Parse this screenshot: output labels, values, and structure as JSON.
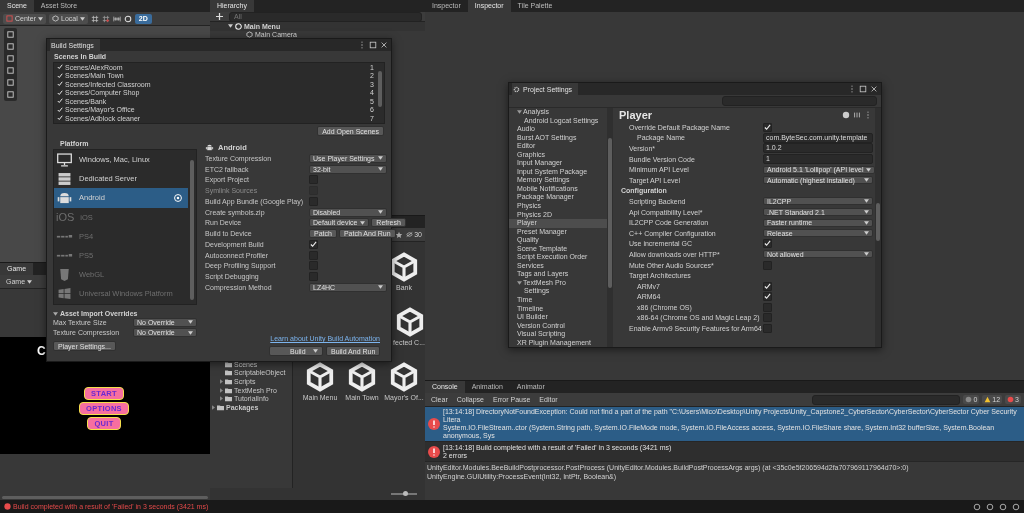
{
  "scene_panel": {
    "tabs": [
      {
        "label": "Scene",
        "selected": true
      },
      {
        "label": "Asset Store",
        "selected": false
      }
    ],
    "toolbar": {
      "pivot": "Center",
      "space": "Local",
      "toggle_2d": {
        "label": "2D",
        "on": true
      }
    }
  },
  "hierarchy": {
    "title": "Hierarchy",
    "search": {
      "placeholder": "All"
    },
    "items": [
      {
        "label": "Main Menu",
        "expanded": true,
        "children": [
          {
            "label": "Main Camera"
          }
        ]
      }
    ]
  },
  "inspector_panel": {
    "tabs": [
      {
        "label": "Inspector",
        "selected": false
      },
      {
        "label": "Inspector",
        "selected": true
      },
      {
        "label": "Tile Palette",
        "selected": false
      }
    ]
  },
  "game_panel": {
    "tab": "Game",
    "display": "Game",
    "title_fragment": "C",
    "menu_buttons": [
      "START",
      "OPTIONS",
      "QUIT"
    ]
  },
  "project_panel": {
    "count": "30",
    "asset_folders": [
      {
        "label": "Scenes",
        "expandable": false
      },
      {
        "label": "ScriptableObject",
        "expandable": false
      },
      {
        "label": "Scripts",
        "expandable": true
      },
      {
        "label": "TextMesh Pro",
        "expandable": true
      },
      {
        "label": "TutorialInfo",
        "expandable": true
      }
    ],
    "root_folders": [
      {
        "label": "Packages",
        "expandable": true
      }
    ],
    "assets": [
      "Bank",
      "fected C...",
      "Main Menu",
      "Main Town",
      "Mayor's Of..."
    ],
    "zoom_slider": {
      "level": 0.55
    }
  },
  "build_settings": {
    "title": "Build Settings",
    "scenes_header": "Scenes In Build",
    "scenes": [
      {
        "path": "Scenes/AlexRoom",
        "index": "1",
        "checked": true
      },
      {
        "path": "Scenes/Main Town",
        "index": "2",
        "checked": true
      },
      {
        "path": "Scenes/Infected Classroom",
        "index": "3",
        "checked": true
      },
      {
        "path": "Scenes/Computer Shop",
        "index": "4",
        "checked": true
      },
      {
        "path": "Scenes/Bank",
        "index": "5",
        "checked": true
      },
      {
        "path": "Scenes/Mayor's Office",
        "index": "6",
        "checked": true
      },
      {
        "path": "Scenes/Adblock cleaner",
        "index": "7",
        "checked": true
      }
    ],
    "add_open_scenes": "Add Open Scenes",
    "platform_header": "Platform",
    "platforms": [
      {
        "name": "Windows, Mac, Linux",
        "kind": "monitor",
        "installed": true,
        "selected": false,
        "active": false
      },
      {
        "name": "Dedicated Server",
        "kind": "server",
        "installed": true,
        "selected": false,
        "active": false
      },
      {
        "name": "Android",
        "kind": "android",
        "installed": true,
        "selected": true,
        "active": true
      },
      {
        "name": "iOS",
        "kind": "ios",
        "icon_text": "iOS",
        "installed": false,
        "selected": false,
        "active": false
      },
      {
        "name": "PS4",
        "kind": "ps4",
        "installed": false,
        "selected": false,
        "active": false
      },
      {
        "name": "PS5",
        "kind": "ps5",
        "installed": false,
        "selected": false,
        "active": false
      },
      {
        "name": "WebGL",
        "kind": "webgl",
        "installed": false,
        "selected": false,
        "active": false
      },
      {
        "name": "Universal Windows Platform",
        "kind": "windows",
        "installed": false,
        "selected": false,
        "active": false
      }
    ],
    "platform_title": "Android",
    "settings": [
      {
        "label": "Texture Compression",
        "kind": "dropdown",
        "value": "Use Player Settings",
        "disabled": false
      },
      {
        "label": "ETC2 fallback",
        "kind": "dropdown",
        "value": "32-bit",
        "disabled": false
      },
      {
        "label": "Export Project",
        "kind": "checkbox",
        "checked": false,
        "disabled": false
      },
      {
        "label": "Symlink Sources",
        "kind": "checkbox",
        "checked": false,
        "disabled": true
      },
      {
        "label": "Build App Bundle (Google Play)",
        "kind": "checkbox",
        "checked": false,
        "disabled": false
      },
      {
        "label": "Create symbols.zip",
        "kind": "dropdown",
        "value": "Disabled",
        "disabled": false
      },
      {
        "label": "Run Device",
        "kind": "device",
        "value": "Default device",
        "button": "Refresh",
        "disabled": false
      },
      {
        "label": "Build to Device",
        "kind": "buttons",
        "buttons": [
          "Patch",
          "Patch And Run"
        ],
        "disabled": false
      },
      {
        "label": "Development Build",
        "kind": "checkbox",
        "checked": true,
        "disabled": false
      },
      {
        "label": "Autoconnect Profiler",
        "kind": "checkbox",
        "checked": false,
        "disabled": false
      },
      {
        "label": "Deep Profiling Support",
        "kind": "checkbox",
        "checked": false,
        "disabled": false
      },
      {
        "label": "Script Debugging",
        "kind": "checkbox",
        "checked": false,
        "disabled": false
      },
      {
        "label": "Compression Method",
        "kind": "dropdown",
        "value": "LZ4HC",
        "disabled": false
      }
    ],
    "overrides": {
      "title": "Asset Import Overrides",
      "expanded": true,
      "rows": [
        {
          "label": "Max Texture Size",
          "value": "No Override"
        },
        {
          "label": "Texture Compression",
          "value": "No Override"
        }
      ]
    },
    "learn_link": "Learn about Unity Build Automation",
    "player_settings": "Player Settings...",
    "build": "Build",
    "build_and_run": "Build And Run"
  },
  "project_settings": {
    "title": "Project Settings",
    "nav": [
      {
        "label": "Analysis",
        "expanded": true,
        "selected": false,
        "children": [
          {
            "label": "Android Logcat Settings",
            "selected": false
          }
        ]
      },
      {
        "label": "Audio",
        "selected": false
      },
      {
        "label": "Burst AOT Settings",
        "selected": false
      },
      {
        "label": "Editor",
        "selected": false
      },
      {
        "label": "Graphics",
        "selected": false
      },
      {
        "label": "Input Manager",
        "selected": false
      },
      {
        "label": "Input System Package",
        "selected": false
      },
      {
        "label": "Memory Settings",
        "selected": false
      },
      {
        "label": "Mobile Notifications",
        "selected": false
      },
      {
        "label": "Package Manager",
        "selected": false
      },
      {
        "label": "Physics",
        "selected": false
      },
      {
        "label": "Physics 2D",
        "selected": false
      },
      {
        "label": "Player",
        "selected": true
      },
      {
        "label": "Preset Manager",
        "selected": false
      },
      {
        "label": "Quality",
        "selected": false
      },
      {
        "label": "Scene Template",
        "selected": false
      },
      {
        "label": "Script Execution Order",
        "selected": false
      },
      {
        "label": "Services",
        "selected": false
      },
      {
        "label": "Tags and Layers",
        "selected": false
      },
      {
        "label": "TextMesh Pro",
        "expanded": true,
        "selected": false,
        "children": [
          {
            "label": "Settings",
            "selected": false
          }
        ]
      },
      {
        "label": "Time",
        "selected": false
      },
      {
        "label": "Timeline",
        "selected": false
      },
      {
        "label": "UI Builder",
        "selected": false
      },
      {
        "label": "Version Control",
        "selected": false
      },
      {
        "label": "Visual Scripting",
        "selected": false
      },
      {
        "label": "XR Plugin Management",
        "selected": false
      }
    ],
    "page_title": "Player",
    "rows": [
      {
        "label": "Override Default Package Name",
        "kind": "checkbox",
        "checked": true,
        "children": [
          {
            "label": "Package Name",
            "kind": "text",
            "value": "com.ByteSec.com.unity.template"
          }
        ]
      },
      {
        "label": "Version*",
        "kind": "text",
        "value": "1.0.2"
      },
      {
        "label": "Bundle Version Code",
        "kind": "text",
        "value": "1"
      },
      {
        "label": "Minimum API Level",
        "kind": "dropdown",
        "value": "Android 5.1 'Lollipop' (API level"
      },
      {
        "label": "Target API Level",
        "kind": "dropdown",
        "value": "Automatic (highest installed)"
      },
      {
        "label": "Configuration",
        "kind": "section"
      },
      {
        "label": "Scripting Backend",
        "kind": "dropdown",
        "value": "IL2CPP"
      },
      {
        "label": "Api Compatibility Level*",
        "kind": "dropdown",
        "value": ".NET Standard 2.1"
      },
      {
        "label": "IL2CPP Code Generation",
        "kind": "dropdown",
        "value": "Faster runtime"
      },
      {
        "label": "C++ Compiler Configuration",
        "kind": "dropdown",
        "value": "Release"
      },
      {
        "label": "Use incremental GC",
        "kind": "checkbox",
        "checked": true
      },
      {
        "label": "Allow downloads over HTTP*",
        "kind": "dropdown",
        "value": "Not allowed"
      },
      {
        "label": "Mute Other Audio Sources*",
        "kind": "checkbox",
        "checked": false
      },
      {
        "label": "Target Architectures",
        "kind": "label",
        "children": [
          {
            "label": "ARMv7",
            "kind": "checkbox",
            "checked": true
          },
          {
            "label": "ARM64",
            "kind": "checkbox",
            "checked": true
          },
          {
            "label": "x86 (Chrome OS)",
            "kind": "checkbox",
            "checked": false
          },
          {
            "label": "x86-64 (Chrome OS and Magic Leap 2)",
            "kind": "checkbox",
            "checked": false
          }
        ]
      },
      {
        "label": "Enable Armv9 Security Features for Arm64",
        "kind": "checkbox",
        "checked": false
      }
    ]
  },
  "console": {
    "tabs": [
      {
        "label": "Console",
        "selected": true
      },
      {
        "label": "Animation",
        "selected": false
      },
      {
        "label": "Animator",
        "selected": false
      }
    ],
    "toolbar": [
      "Clear",
      "Collapse",
      "Error Pause",
      "Editor"
    ],
    "counts": [
      {
        "kind": "info",
        "value": "0"
      },
      {
        "kind": "warning",
        "value": "12"
      },
      {
        "kind": "error",
        "value": "3"
      }
    ],
    "logs": [
      {
        "text": "[13:14:18] DirectoryNotFoundException: Could not find a part of the path \"C:\\Users\\Mico\\Desktop\\Unity Projects\\Unity_Capstone2_CyberSector\\CyberSector\\CyberSector Cyber Security Litera",
        "detail": "System.IO.FileStream..ctor (System.String path, System.IO.FileMode mode, System.IO.FileAccess access, System.IO.FileShare share, System.Int32 bufferSize, System.Boolean anonymous, Sys",
        "selected": true
      },
      {
        "text": "[13:14:18] Build completed with a result of 'Failed' in 3 seconds (3421 ms)",
        "detail": "2 errors",
        "selected": false
      }
    ],
    "stack": [
      "UnityEditor.Modules.BeeBuildPostprocessor.PostProcess (UnityEditor.Modules.BuildPostProcessArgs args) (at <35c0e5f206594d2fa707969117964d70>:0)",
      "UnityEngine.GUIUtility:ProcessEvent(Int32, IntPtr, Boolean&)"
    ]
  },
  "status_bar": {
    "message": "Build completed with a result of 'Failed' in 3 seconds (3421 ms)"
  }
}
